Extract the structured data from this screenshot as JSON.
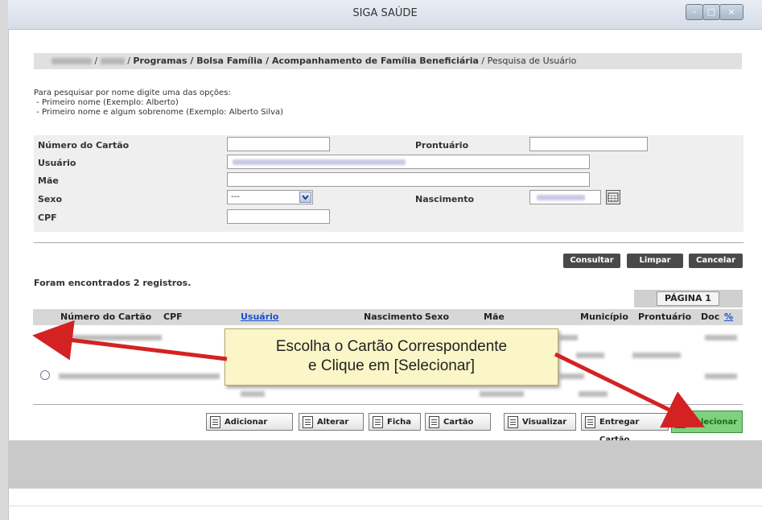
{
  "window": {
    "title": "SIGA SAÚDE",
    "min_symbol": "–",
    "max_symbol": "□",
    "close_symbol": "×"
  },
  "breadcrumb": {
    "sep1": " / ",
    "sep2": " / ",
    "path_bold": "Programas / Bolsa Família / Acompanhamento de Família Beneficiária",
    "current": " / Pesquisa de Usuário"
  },
  "instructions": {
    "line1": "Para pesquisar por nome digite uma das opções:",
    "line2": " - Primeiro nome (Exemplo: Alberto)",
    "line3": " - Primeiro nome e algum sobrenome (Exemplo: Alberto Silva)"
  },
  "form": {
    "numero_cartao_label": "Número do Cartão",
    "prontuario_label": "Prontuário",
    "usuario_label": "Usuário",
    "mae_label": "Mãe",
    "sexo_label": "Sexo",
    "sexo_value": "---",
    "nascimento_label": "Nascimento",
    "cpf_label": "CPF"
  },
  "actions": {
    "consultar": "Consultar",
    "limpar": "Limpar",
    "cancelar": "Cancelar"
  },
  "results": {
    "count_text": "Foram encontrados 2 registros.",
    "page_label": "PÁGINA 1"
  },
  "table": {
    "headers": {
      "numero_cartao": "Número do Cartão",
      "cpf": "CPF",
      "usuario": "Usuário",
      "nascimento": "Nascimento",
      "sexo": "Sexo",
      "mae": "Mãe",
      "municipio": "Município",
      "prontuario": "Prontuário",
      "doc": "Doc",
      "pct": "%"
    }
  },
  "callout": {
    "line1": "Escolha o Cartão Correspondente",
    "line2": "e Clique em [Selecionar]",
    "arrow_color": "#d42222"
  },
  "toolbar": {
    "adicionar": "Adicionar",
    "alterar": "Alterar",
    "ficha": "Ficha",
    "cartao": "Cartão",
    "visualizar": "Visualizar",
    "entregar_cartao": "Entregar Cartão",
    "selecionar": "Selecionar"
  },
  "colors": {
    "selecionar_bg": "#7fd07f",
    "selecionar_text": "#1a6b1a",
    "dark_button": "#4a4a4a",
    "header_gray": "#d7d7d7"
  }
}
